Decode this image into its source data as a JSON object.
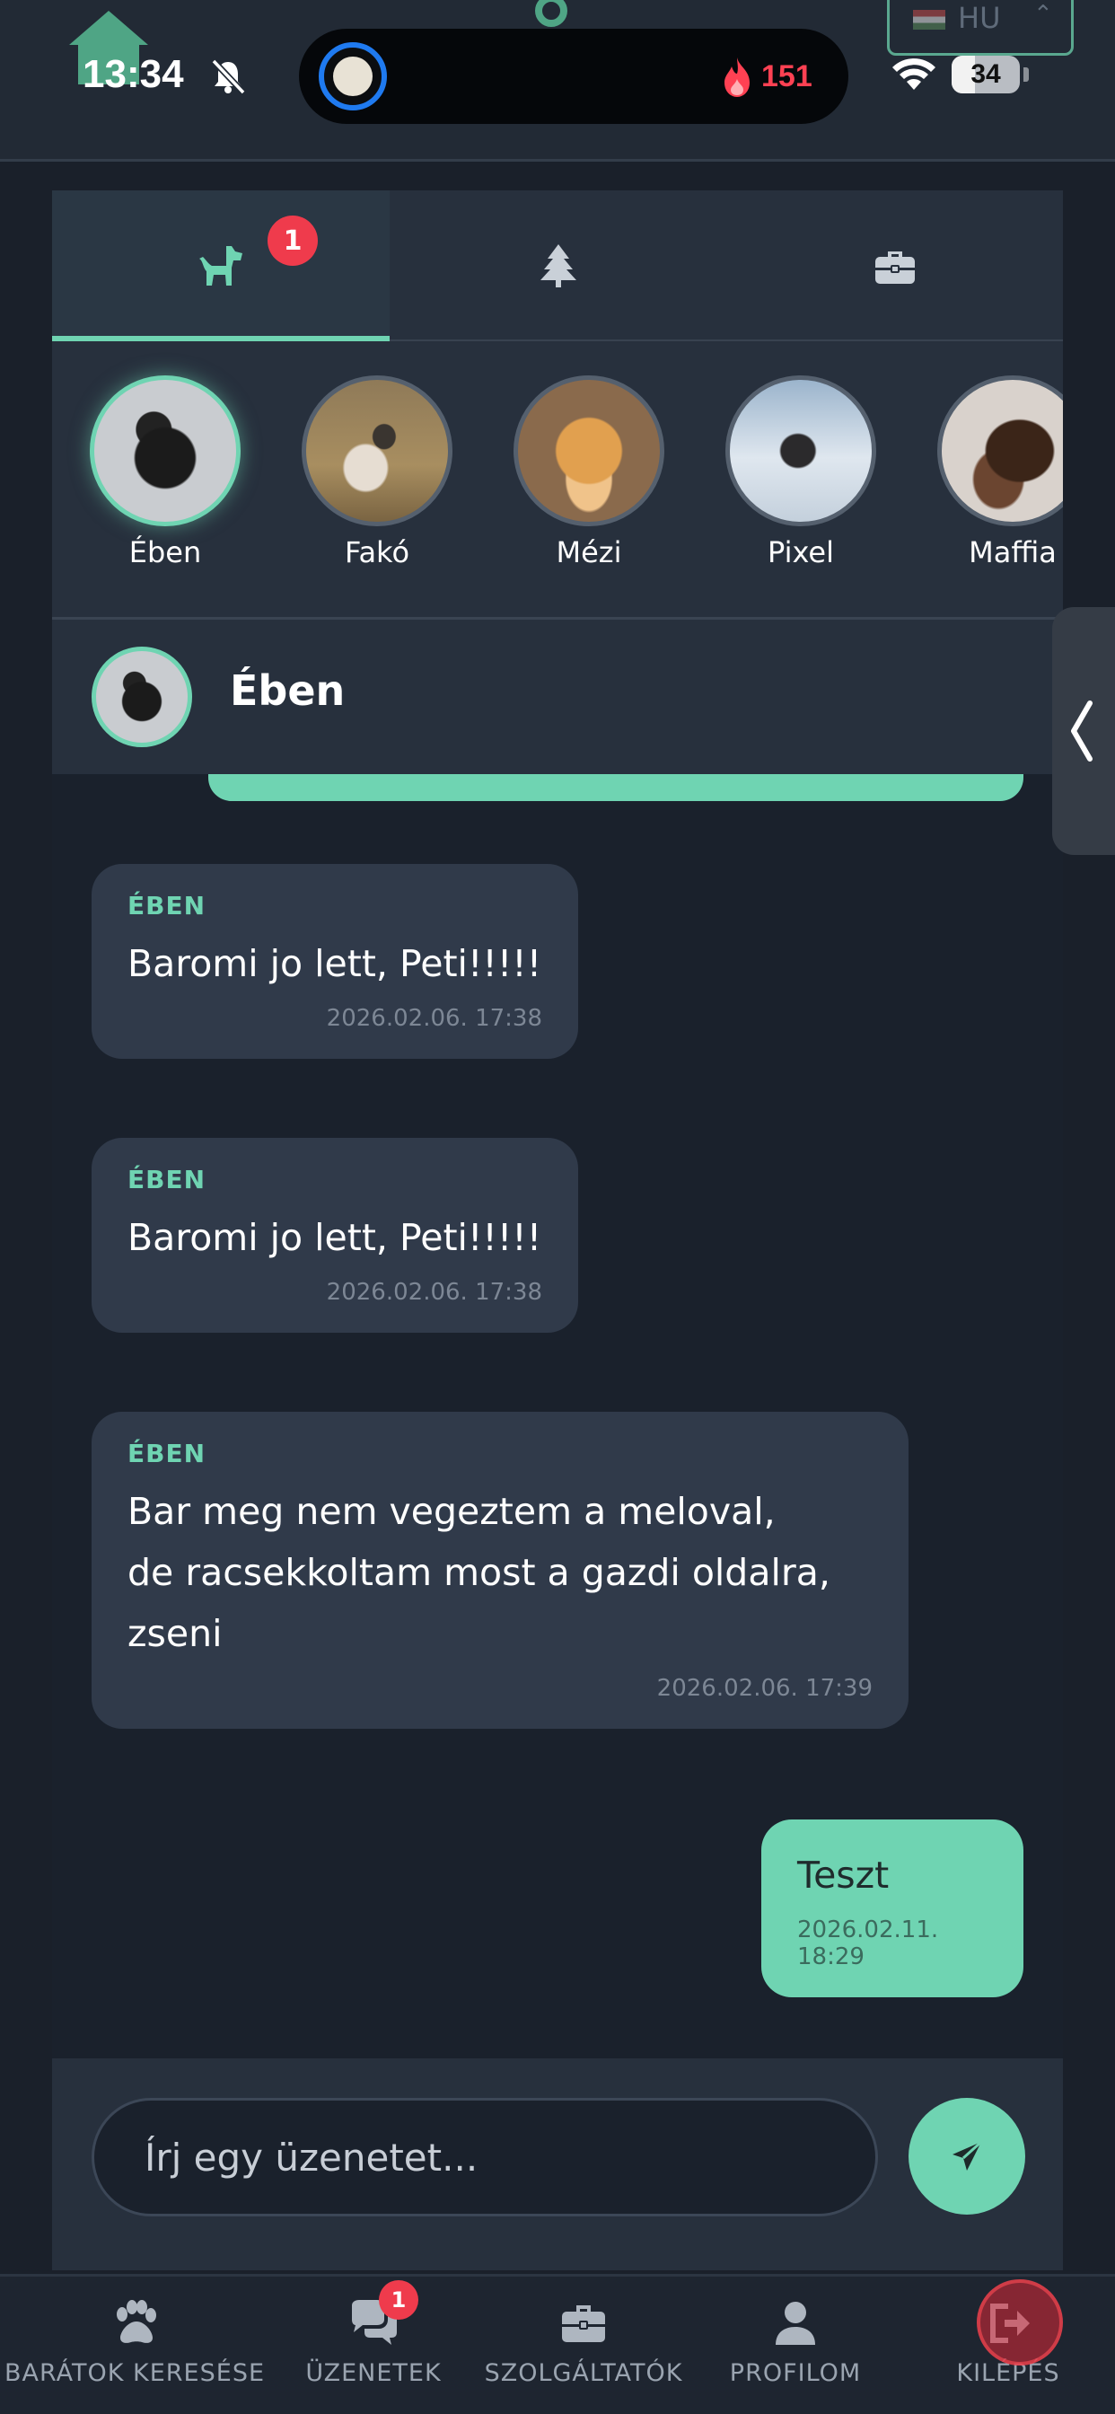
{
  "status_bar": {
    "time": "13:34",
    "streak_count": "151",
    "battery_percent": "34",
    "battery_level": 0.34,
    "language": "HU",
    "icons": [
      "home-icon",
      "bell-off-icon",
      "fire-icon",
      "wifi-icon",
      "battery-icon",
      "chevron-updown-icon"
    ]
  },
  "tabs": [
    {
      "icon": "dog-icon",
      "badge": "1",
      "active": true
    },
    {
      "icon": "tree-icon",
      "active": false
    },
    {
      "icon": "briefcase-icon",
      "active": false
    }
  ],
  "pets": [
    {
      "name": "Ében",
      "selected": true
    },
    {
      "name": "Fakó",
      "selected": false
    },
    {
      "name": "Mézi",
      "selected": false
    },
    {
      "name": "Pixel",
      "selected": false
    },
    {
      "name": "Maffia",
      "selected": false
    }
  ],
  "chat": {
    "title": "Ében",
    "messages": [
      {
        "direction": "in",
        "sender": "ÉBEN",
        "text": "Baromi jo lett, Peti!!!!!",
        "time": "2026.02.06. 17:38"
      },
      {
        "direction": "in",
        "sender": "ÉBEN",
        "text": "Baromi jo lett, Peti!!!!!",
        "time": "2026.02.06. 17:38"
      },
      {
        "direction": "in",
        "sender": "ÉBEN",
        "text_lines": [
          "Bar meg nem vegeztem a meloval,",
          "de racsekkoltam most a gazdi oldalra,",
          "zseni"
        ],
        "time": "2026.02.06. 17:39"
      },
      {
        "direction": "out",
        "text": "Teszt",
        "time": "2026.02.11. 18:29"
      }
    ]
  },
  "composer": {
    "placeholder": "Írj egy üzenetet...",
    "send_icon": "send-icon"
  },
  "bottom_nav": [
    {
      "label": "BARÁTOK KERESÉSE",
      "icon": "paw-icon"
    },
    {
      "label": "ÜZENETEK",
      "icon": "chat-bubbles-icon",
      "badge": "1"
    },
    {
      "label": "SZOLGÁLTATÓK",
      "icon": "briefcase-icon"
    },
    {
      "label": "PROFILOM",
      "icon": "user-icon"
    },
    {
      "label": "KILÉPÉS",
      "icon": "logout-icon"
    }
  ],
  "colors": {
    "accent": "#6fd4b2",
    "badge": "#ef3b4c",
    "background": "#1a212c",
    "panel": "#27303d",
    "bubble_in": "#303a4a"
  }
}
